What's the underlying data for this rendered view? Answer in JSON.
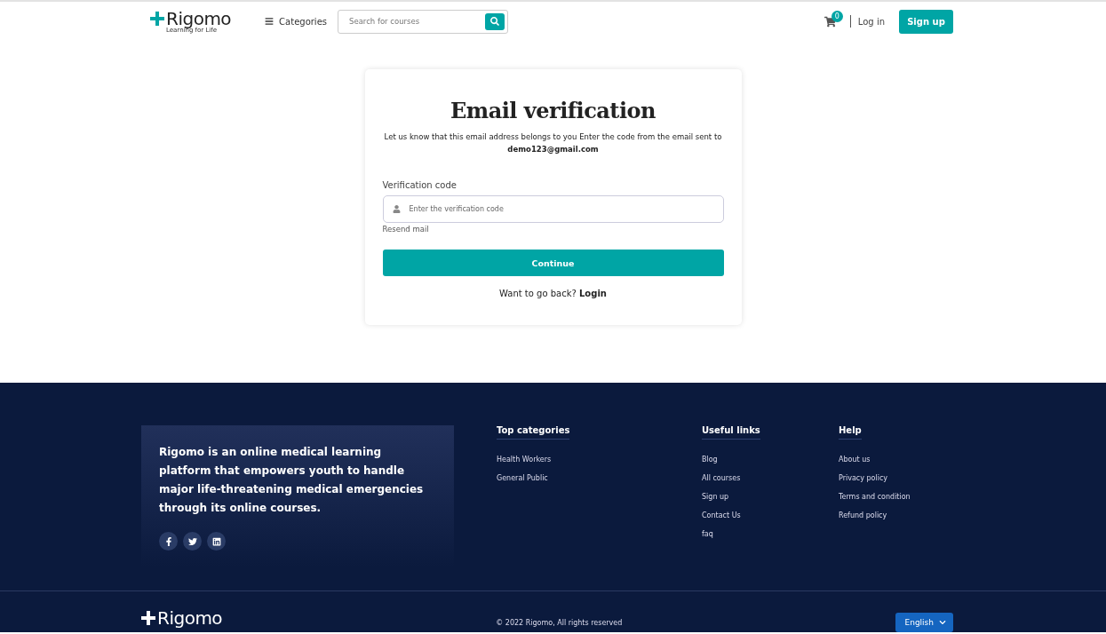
{
  "header": {
    "logo": {
      "name": "Rigomo",
      "tagline": "Learning for Life"
    },
    "categories": "Categories",
    "search": {
      "placeholder": "Search for courses"
    },
    "cart_count": "0",
    "login": "Log in",
    "signup": "Sign up"
  },
  "card": {
    "title": "Email verification",
    "message": "Let us know that this email address belongs to you Enter the code from the email sent to **demo123@gmail.com**",
    "field_label": "Verification code",
    "field": {
      "placeholder": "Enter the verification code"
    },
    "resend": "Resend mail",
    "continue": "Continue",
    "back_text": "Want to go back?",
    "back_link": "Login"
  },
  "footer": {
    "about": "Rigomo is an online medical learning platform that empowers youth to handle major life-threatening medical emergencies through its online courses.",
    "socials": [
      {
        "kind": "facebook"
      },
      {
        "kind": "twitter"
      },
      {
        "kind": "linkedin"
      }
    ],
    "columns": [
      {
        "title": "Top categories",
        "links": [
          "Health Workers",
          "General Public"
        ]
      },
      {
        "title": "Useful links",
        "links": [
          "Blog",
          "All courses",
          "Sign up",
          "Contact Us",
          "faq"
        ]
      },
      {
        "title": "Help",
        "links": [
          "About us",
          "Privacy policy",
          "Terms and condition",
          "Refund policy"
        ]
      }
    ],
    "bottom": {
      "logo": "Rigomo",
      "copyright": "© 2022 Rigomo, All rights reserved",
      "language": "English"
    }
  }
}
